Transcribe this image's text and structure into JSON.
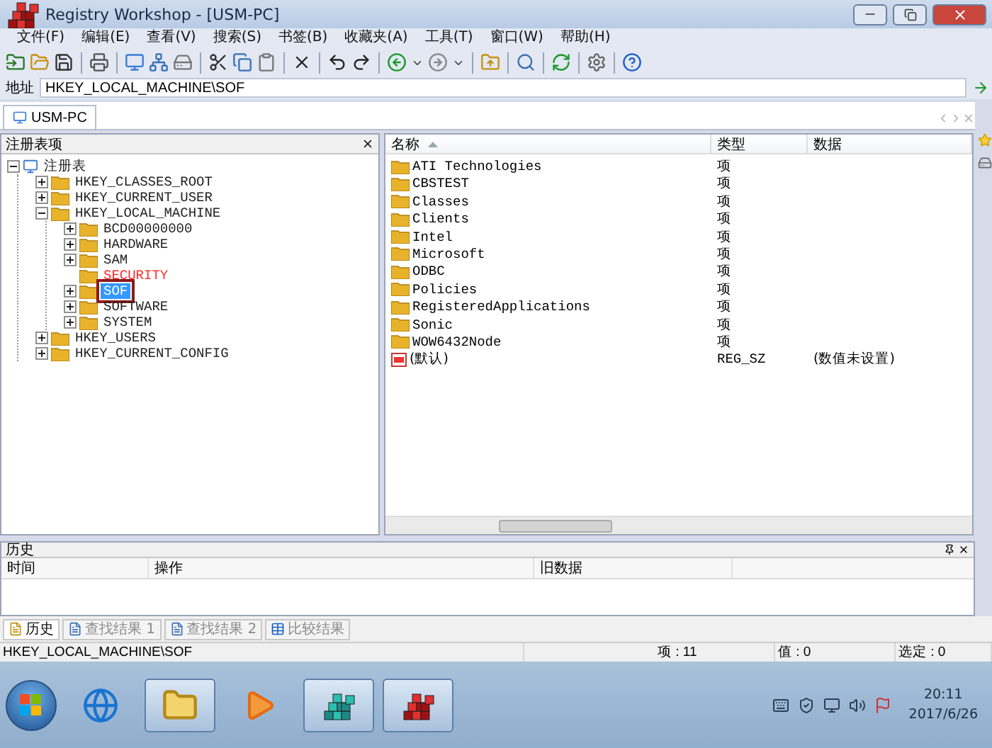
{
  "window": {
    "title": "Registry Workshop - [USM-PC]"
  },
  "menu": [
    "文件(F)",
    "编辑(E)",
    "查看(V)",
    "搜索(S)",
    "书签(B)",
    "收藏夹(A)",
    "工具(T)",
    "窗口(W)",
    "帮助(H)"
  ],
  "address": {
    "label": "地址",
    "value": "HKEY_LOCAL_MACHINE\\SOF"
  },
  "document_tabs": [
    {
      "label": "USM-PC",
      "selected": true
    }
  ],
  "tree": {
    "title": "注册表项",
    "root": {
      "label": "注册表",
      "expandable": true,
      "expanded": true,
      "selected": false,
      "restricted": false,
      "marked": false,
      "children": [
        {
          "label": "HKEY_CLASSES_ROOT",
          "expandable": true,
          "expanded": false,
          "selected": false,
          "restricted": false,
          "marked": false
        },
        {
          "label": "HKEY_CURRENT_USER",
          "expandable": true,
          "expanded": false,
          "selected": false,
          "restricted": false,
          "marked": false
        },
        {
          "label": "HKEY_LOCAL_MACHINE",
          "expandable": true,
          "expanded": true,
          "selected": false,
          "restricted": false,
          "marked": false,
          "children": [
            {
              "label": "BCD00000000",
              "expandable": true,
              "expanded": false,
              "selected": false,
              "restricted": false,
              "marked": false
            },
            {
              "label": "HARDWARE",
              "expandable": true,
              "expanded": false,
              "selected": false,
              "restricted": false,
              "marked": false
            },
            {
              "label": "SAM",
              "expandable": true,
              "expanded": false,
              "selected": false,
              "restricted": false,
              "marked": false
            },
            {
              "label": "SECURITY",
              "expandable": false,
              "expanded": false,
              "selected": false,
              "restricted": true,
              "marked": false
            },
            {
              "label": "SOF",
              "expandable": true,
              "expanded": false,
              "selected": true,
              "restricted": false,
              "marked": true
            },
            {
              "label": "SOFTWARE",
              "expandable": true,
              "expanded": false,
              "selected": false,
              "restricted": false,
              "marked": false
            },
            {
              "label": "SYSTEM",
              "expandable": true,
              "expanded": false,
              "selected": false,
              "restricted": false,
              "marked": false
            }
          ]
        },
        {
          "label": "HKEY_USERS",
          "expandable": true,
          "expanded": false,
          "selected": false,
          "restricted": false,
          "marked": false
        },
        {
          "label": "HKEY_CURRENT_CONFIG",
          "expandable": true,
          "expanded": false,
          "selected": false,
          "restricted": false,
          "marked": false
        }
      ]
    }
  },
  "list": {
    "columns": [
      {
        "label": "名称",
        "sorted": true
      },
      {
        "label": "类型",
        "sorted": false
      },
      {
        "label": "数据",
        "sorted": false
      }
    ],
    "rows": [
      {
        "kind": "key",
        "name": "ATI Technologies",
        "type": "项"
      },
      {
        "kind": "key",
        "name": "CBSTEST",
        "type": "项"
      },
      {
        "kind": "key",
        "name": "Classes",
        "type": "项"
      },
      {
        "kind": "key",
        "name": "Clients",
        "type": "项"
      },
      {
        "kind": "key",
        "name": "Intel",
        "type": "项"
      },
      {
        "kind": "key",
        "name": "Microsoft",
        "type": "项"
      },
      {
        "kind": "key",
        "name": "ODBC",
        "type": "项"
      },
      {
        "kind": "key",
        "name": "Policies",
        "type": "项"
      },
      {
        "kind": "key",
        "name": "RegisteredApplications",
        "type": "项"
      },
      {
        "kind": "key",
        "name": "Sonic",
        "type": "项"
      },
      {
        "kind": "key",
        "name": "WOW6432Node",
        "type": "项"
      },
      {
        "kind": "string",
        "name": "(默认)",
        "type": "REG_SZ",
        "data": "(数值未设置)"
      }
    ]
  },
  "history": {
    "title": "历史",
    "columns": [
      "时间",
      "操作",
      "旧数据"
    ]
  },
  "bottom_tabs": [
    {
      "kind": "history",
      "label": "历史",
      "selected": true
    },
    {
      "kind": "find",
      "label": "查找结果 1",
      "selected": false
    },
    {
      "kind": "find",
      "label": "查找结果 2",
      "selected": false
    },
    {
      "kind": "compare",
      "label": "比较结果",
      "selected": false
    }
  ],
  "status_bar": [
    "HKEY_LOCAL_MACHINE\\SOF",
    "项 : 11",
    "值 : 0",
    "选定 : 0"
  ],
  "taskbar": {
    "apps": [
      {
        "kind": "browser",
        "running": false
      },
      {
        "kind": "files",
        "running": true
      },
      {
        "kind": "media",
        "running": false
      },
      {
        "kind": "registry",
        "running": true
      },
      {
        "kind": "registry-red",
        "running": true
      }
    ],
    "clock": {
      "time": "20:11",
      "date": "2017/6/26"
    }
  }
}
